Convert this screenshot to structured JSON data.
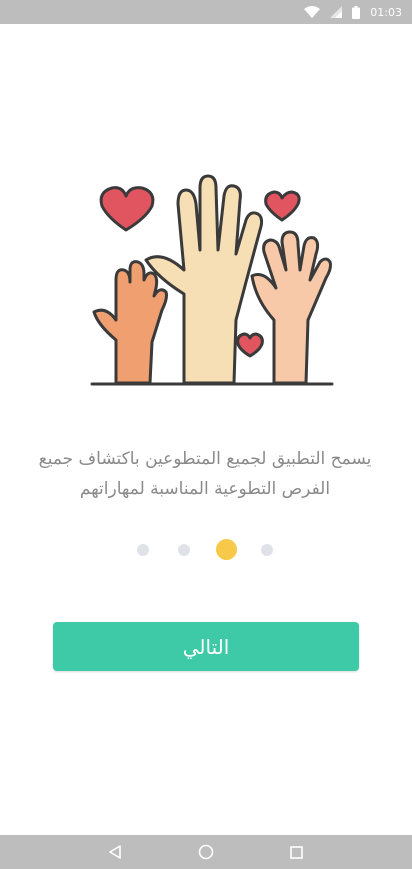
{
  "status_bar": {
    "time": "01:03",
    "icons": [
      "wifi-icon",
      "signal-icon",
      "battery-icon"
    ]
  },
  "illustration": {
    "icon": "raised-hands-hearts-illustration"
  },
  "onboarding": {
    "description": "يسمح التطبيق لجميع المتطوعين باكتشاف جميع الفرص التطوعية المناسبة لمهاراتهم",
    "page_count": 4,
    "active_page": 3,
    "next_label": "التالي"
  },
  "colors": {
    "accent": "#3ec9a7",
    "active_dot": "#f8c84a",
    "inactive_dot": "#dfe3e8",
    "text": "#8a8a8a"
  },
  "nav_bar": {
    "icons": [
      "back-icon",
      "home-icon",
      "recents-icon"
    ]
  }
}
